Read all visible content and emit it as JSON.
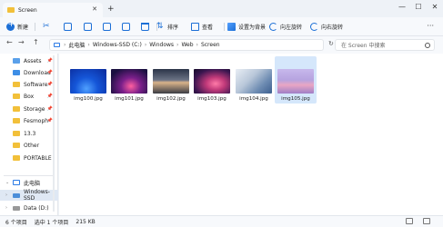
{
  "window": {
    "tab_title": "Screen",
    "tab_close": "✕",
    "new_tab": "+",
    "minimize": "—",
    "maximize": "☐",
    "close": "✕"
  },
  "toolbar": {
    "new_label": "新建",
    "sort_label": "排序",
    "view_label": "查看",
    "set_wallpaper_label": "设置为背景",
    "rotate_left_label": "向左旋转",
    "rotate_right_label": "向右旋转",
    "more_label": "···"
  },
  "navigation": {
    "back": "←",
    "forward": "→",
    "up": "↑",
    "breadcrumb": [
      "此电脑",
      "Windows-SSD (C:)",
      "Windows",
      "Web",
      "Screen"
    ],
    "refresh": "↻",
    "search_placeholder": "在 Screen 中搜索"
  },
  "sidebar": {
    "quick_access": [
      {
        "label": "Assets",
        "icon": "folder-blue-icon"
      },
      {
        "label": "Download",
        "icon": "download-folder-icon"
      },
      {
        "label": "Software",
        "icon": "folder-icon"
      },
      {
        "label": "Box",
        "icon": "folder-icon"
      },
      {
        "label": "Storage",
        "icon": "folder-icon"
      },
      {
        "label": "Fesmoph",
        "icon": "folder-icon"
      },
      {
        "label": "13.3",
        "icon": "folder-icon"
      },
      {
        "label": "Other",
        "icon": "folder-icon"
      },
      {
        "label": "PORTABLE",
        "icon": "folder-icon"
      }
    ],
    "pin": "📌",
    "this_pc": "此电脑",
    "drives": [
      {
        "label": "Windows-SSD",
        "selected": true
      },
      {
        "label": "Data (D:)",
        "selected": false
      }
    ],
    "expand": "›",
    "collapse": "⌄"
  },
  "files": [
    {
      "name": "img100.jpg",
      "selected": false
    },
    {
      "name": "img101.jpg",
      "selected": false
    },
    {
      "name": "img102.jpg",
      "selected": false
    },
    {
      "name": "img103.jpg",
      "selected": false
    },
    {
      "name": "img104.jpg",
      "selected": false
    },
    {
      "name": "img105.jpg",
      "selected": true
    }
  ],
  "status": {
    "item_count": "6 个项目",
    "selected_info": "选中 1 个项目",
    "selected_size": "215 KB"
  }
}
